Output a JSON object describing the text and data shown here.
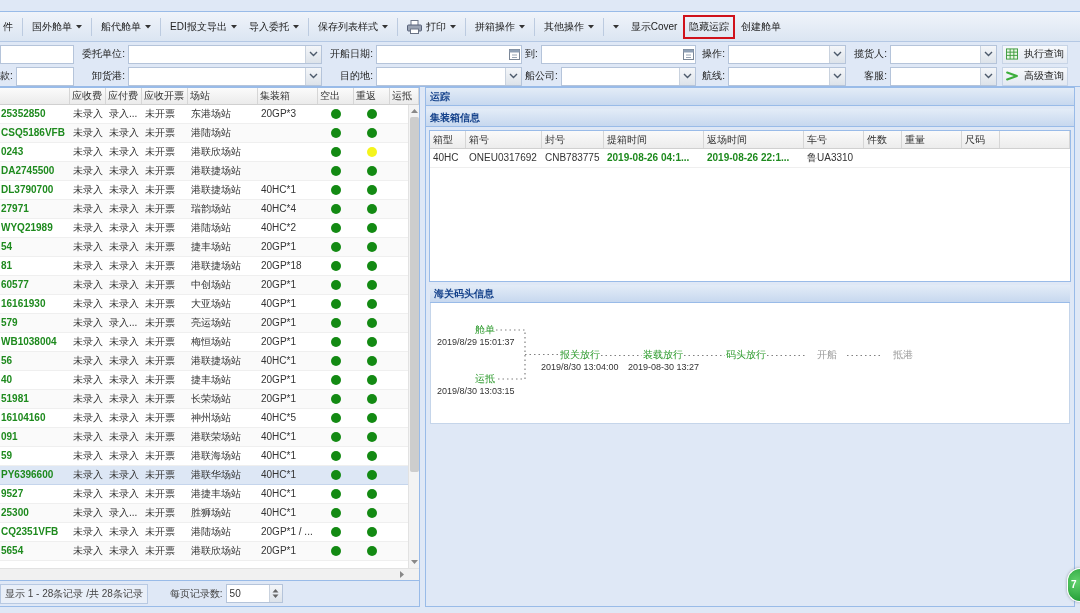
{
  "toolbar": {
    "groups": [
      [
        {
          "label": "件",
          "dropdown": false,
          "highlighted": false
        }
      ],
      [
        {
          "label": "国外舱单",
          "dropdown": true,
          "highlighted": false
        }
      ],
      [
        {
          "label": "船代舱单",
          "dropdown": true,
          "highlighted": false
        }
      ],
      [
        {
          "label": "EDI报文导出",
          "dropdown": true,
          "highlighted": false
        },
        {
          "label": "导入委托",
          "dropdown": true,
          "highlighted": false
        }
      ],
      [
        {
          "label": "保存列表样式",
          "dropdown": true,
          "highlighted": false
        }
      ],
      [
        {
          "label": "打印",
          "dropdown": true,
          "highlighted": false,
          "icon": true
        }
      ],
      [
        {
          "label": "拼箱操作",
          "dropdown": true,
          "highlighted": false
        }
      ],
      [
        {
          "label": "其他操作",
          "dropdown": true,
          "highlighted": false
        }
      ],
      [
        {
          "dropdown": true,
          "highlighted": false
        },
        {
          "label": "显示Cover",
          "dropdown": false,
          "highlighted": false
        },
        {
          "label": "隐藏运踪",
          "dropdown": false,
          "highlighted": true
        },
        {
          "label": "创建舱单",
          "dropdown": false,
          "highlighted": false
        }
      ]
    ]
  },
  "filters": {
    "rows": [
      [
        {
          "kind": "text"
        },
        {
          "kind": "select",
          "label": "委托单位:"
        },
        {
          "kind": "date",
          "label": "开船日期:"
        },
        {
          "kind": "date",
          "label": "到:"
        },
        {
          "kind": "select",
          "label": "操作:"
        },
        {
          "kind": "select",
          "label": "揽货人:"
        },
        {
          "kind": "button",
          "label": "执行查询"
        }
      ],
      [
        {
          "kind": "text",
          "label": "款:"
        },
        {
          "kind": "select",
          "label": "卸货港:"
        },
        {
          "kind": "select",
          "label": "目的地:"
        },
        {
          "kind": "select",
          "label": "船公司:"
        },
        {
          "kind": "select",
          "label": "航线:"
        },
        {
          "kind": "select",
          "label": "客服:"
        },
        {
          "kind": "button",
          "label": "高级查询"
        }
      ]
    ]
  },
  "bills": {
    "columns": [
      "应收费",
      "应付费",
      "应收开票",
      "场站",
      "集装箱",
      "空出",
      "重返",
      "运抵"
    ],
    "rows": [
      {
        "column_1": "25352850",
        "column_2": "未录入",
        "column_3": "录入...",
        "invoice": "未开票",
        "yard": "东港场站",
        "containers": "20GP*3",
        "empty_out": {
          "color": "#138a13"
        },
        "returned": {
          "color": "#138a13"
        },
        "selected": false
      },
      {
        "column_1": "CSQ5186VFB",
        "column_2": "未录入",
        "column_3": "未录入",
        "invoice": "未开票",
        "yard": "港陆场站",
        "empty_out": {
          "color": "#138a13"
        },
        "returned": {
          "color": "#138a13"
        },
        "selected": false
      },
      {
        "column_1": "0243",
        "column_2": "未录入",
        "column_3": "未录入",
        "invoice": "未开票",
        "yard": "港联欣场站",
        "empty_out": {
          "color": "#138a13"
        },
        "returned": {
          "color": "#f4f41c"
        },
        "selected": false
      },
      {
        "column_1": "DA2745500",
        "column_2": "未录入",
        "column_3": "未录入",
        "invoice": "未开票",
        "yard": "港联捷场站",
        "empty_out": {
          "color": "#138a13"
        },
        "returned": {
          "color": "#138a13"
        },
        "selected": false
      },
      {
        "column_1": "DL3790700",
        "column_2": "未录入",
        "column_3": "未录入",
        "invoice": "未开票",
        "yard": "港联捷场站",
        "containers": "40HC*1",
        "empty_out": {
          "color": "#138a13"
        },
        "returned": {
          "color": "#138a13"
        },
        "selected": false
      },
      {
        "column_1": "27971",
        "column_2": "未录入",
        "column_3": "未录入",
        "invoice": "未开票",
        "yard": "瑞韵场站",
        "containers": "40HC*4",
        "empty_out": {
          "color": "#138a13"
        },
        "returned": {
          "color": "#138a13"
        },
        "selected": false
      },
      {
        "column_1": "WYQ21989",
        "column_2": "未录入",
        "column_3": "未录入",
        "invoice": "未开票",
        "yard": "港陆场站",
        "containers": "40HC*2",
        "empty_out": {
          "color": "#138a13"
        },
        "returned": {
          "color": "#138a13"
        },
        "selected": false
      },
      {
        "column_1": "54",
        "column_2": "未录入",
        "column_3": "未录入",
        "invoice": "未开票",
        "yard": "捷丰场站",
        "containers": "20GP*1",
        "empty_out": {
          "color": "#138a13"
        },
        "returned": {
          "color": "#138a13"
        },
        "selected": false
      },
      {
        "column_1": "81",
        "column_2": "未录入",
        "column_3": "未录入",
        "invoice": "未开票",
        "yard": "港联捷场站",
        "containers": "20GP*18",
        "empty_out": {
          "color": "#138a13"
        },
        "returned": {
          "color": "#138a13"
        },
        "selected": false
      },
      {
        "column_1": "60577",
        "column_2": "未录入",
        "column_3": "未录入",
        "invoice": "未开票",
        "yard": "中创场站",
        "containers": "20GP*1",
        "empty_out": {
          "color": "#138a13"
        },
        "returned": {
          "color": "#138a13"
        },
        "selected": false
      },
      {
        "column_1": "16161930",
        "column_2": "未录入",
        "column_3": "未录入",
        "invoice": "未开票",
        "yard": "大亚场站",
        "containers": "40GP*1",
        "empty_out": {
          "color": "#138a13"
        },
        "returned": {
          "color": "#138a13"
        },
        "selected": false
      },
      {
        "column_1": "579",
        "column_2": "未录入",
        "column_3": "录入...",
        "invoice": "未开票",
        "yard": "亮运场站",
        "containers": "20GP*1",
        "empty_out": {
          "color": "#138a13"
        },
        "returned": {
          "color": "#138a13"
        },
        "selected": false
      },
      {
        "column_1": "WB1038004",
        "column_2": "未录入",
        "column_3": "未录入",
        "invoice": "未开票",
        "yard": "梅恒场站",
        "containers": "20GP*1",
        "empty_out": {
          "color": "#138a13"
        },
        "returned": {
          "color": "#138a13"
        },
        "selected": false
      },
      {
        "column_1": "56",
        "column_2": "未录入",
        "column_3": "未录入",
        "invoice": "未开票",
        "yard": "港联捷场站",
        "containers": "40HC*1",
        "empty_out": {
          "color": "#138a13"
        },
        "returned": {
          "color": "#138a13"
        },
        "selected": false
      },
      {
        "column_1": "40",
        "column_2": "未录入",
        "column_3": "未录入",
        "invoice": "未开票",
        "yard": "捷丰场站",
        "containers": "20GP*1",
        "empty_out": {
          "color": "#138a13"
        },
        "returned": {
          "color": "#138a13"
        },
        "selected": false
      },
      {
        "column_1": "51981",
        "column_2": "未录入",
        "column_3": "未录入",
        "invoice": "未开票",
        "yard": "长荣场站",
        "containers": "20GP*1",
        "empty_out": {
          "color": "#138a13"
        },
        "returned": {
          "color": "#138a13"
        },
        "selected": false
      },
      {
        "column_1": "16104160",
        "column_2": "未录入",
        "column_3": "未录入",
        "invoice": "未开票",
        "yard": "神州场站",
        "containers": "40HC*5",
        "empty_out": {
          "color": "#138a13"
        },
        "returned": {
          "color": "#138a13"
        },
        "selected": false
      },
      {
        "column_1": "091",
        "column_2": "未录入",
        "column_3": "未录入",
        "invoice": "未开票",
        "yard": "港联荣场站",
        "containers": "40HC*1",
        "empty_out": {
          "color": "#138a13"
        },
        "returned": {
          "color": "#138a13"
        },
        "selected": false
      },
      {
        "column_1": "59",
        "column_2": "未录入",
        "column_3": "未录入",
        "invoice": "未开票",
        "yard": "港联海场站",
        "containers": "40HC*1",
        "empty_out": {
          "color": "#138a13"
        },
        "returned": {
          "color": "#138a13"
        },
        "selected": false
      },
      {
        "column_1": "PY6396600",
        "column_2": "未录入",
        "column_3": "未录入",
        "invoice": "未开票",
        "yard": "港联华场站",
        "containers": "40HC*1",
        "empty_out": {
          "color": "#138a13"
        },
        "returned": {
          "color": "#138a13"
        },
        "selected": true
      },
      {
        "column_1": "9527",
        "column_2": "未录入",
        "column_3": "未录入",
        "invoice": "未开票",
        "yard": "港捷丰场站",
        "containers": "40HC*1",
        "empty_out": {
          "color": "#138a13"
        },
        "returned": {
          "color": "#138a13"
        },
        "selected": false
      },
      {
        "column_1": "25300",
        "column_2": "未录入",
        "column_3": "录入...",
        "invoice": "未开票",
        "yard": "胜狮场站",
        "containers": "40HC*1",
        "empty_out": {
          "color": "#138a13"
        },
        "returned": {
          "color": "#138a13"
        },
        "selected": false
      },
      {
        "column_1": "CQ2351VFB",
        "column_2": "未录入",
        "column_3": "未录入",
        "invoice": "未开票",
        "yard": "港陆场站",
        "containers": "20GP*1 / ...",
        "empty_out": {
          "color": "#138a13"
        },
        "returned": {
          "color": "#138a13"
        },
        "selected": false
      },
      {
        "column_1": "5654",
        "column_2": "未录入",
        "column_3": "未录入",
        "invoice": "未开票",
        "yard": "港联欣场站",
        "containers": "20GP*1",
        "empty_out": {
          "color": "#138a13"
        },
        "returned": {
          "color": "#138a13"
        },
        "selected": false
      }
    ],
    "pager": {
      "summary": "显示 1 - 28条记录 /共 28条记录",
      "page_size_label": "每页记录数:",
      "page_size": "50"
    }
  },
  "tracking": {
    "title": "运踪",
    "containers": {
      "title": "集装箱信息",
      "columns": [
        "箱型",
        "箱号",
        "封号",
        "提箱时间",
        "返场时间",
        "车号",
        "件数",
        "重量",
        "尺码"
      ],
      "rows": [
        {
          "type": "40HC",
          "number": "ONEU0317692",
          "seal": "CNB783775",
          "pickup_time": "2019-08-26 04:1...",
          "return_time": "2019-08-26 22:1...",
          "truck": "鲁UA3310"
        }
      ]
    },
    "customs": {
      "title": "海关码头信息",
      "branches": [
        {
          "label": "舱单",
          "time": "2019/8/29 15:01:37",
          "done": true
        },
        {
          "label": "运抵",
          "time": "2019/8/30 13:03:15",
          "done": true
        }
      ],
      "steps": [
        {
          "label": "报关放行",
          "time": "2019/8/30 13:04:00",
          "done": true
        },
        {
          "label": "装载放行",
          "time": "2019-08-30 13:27",
          "done": true
        },
        {
          "label": "码头放行",
          "done": true
        },
        {
          "label": "开船",
          "done": false
        },
        {
          "label": "抵港",
          "done": false
        }
      ]
    }
  },
  "floating_button": {
    "label": "7"
  }
}
